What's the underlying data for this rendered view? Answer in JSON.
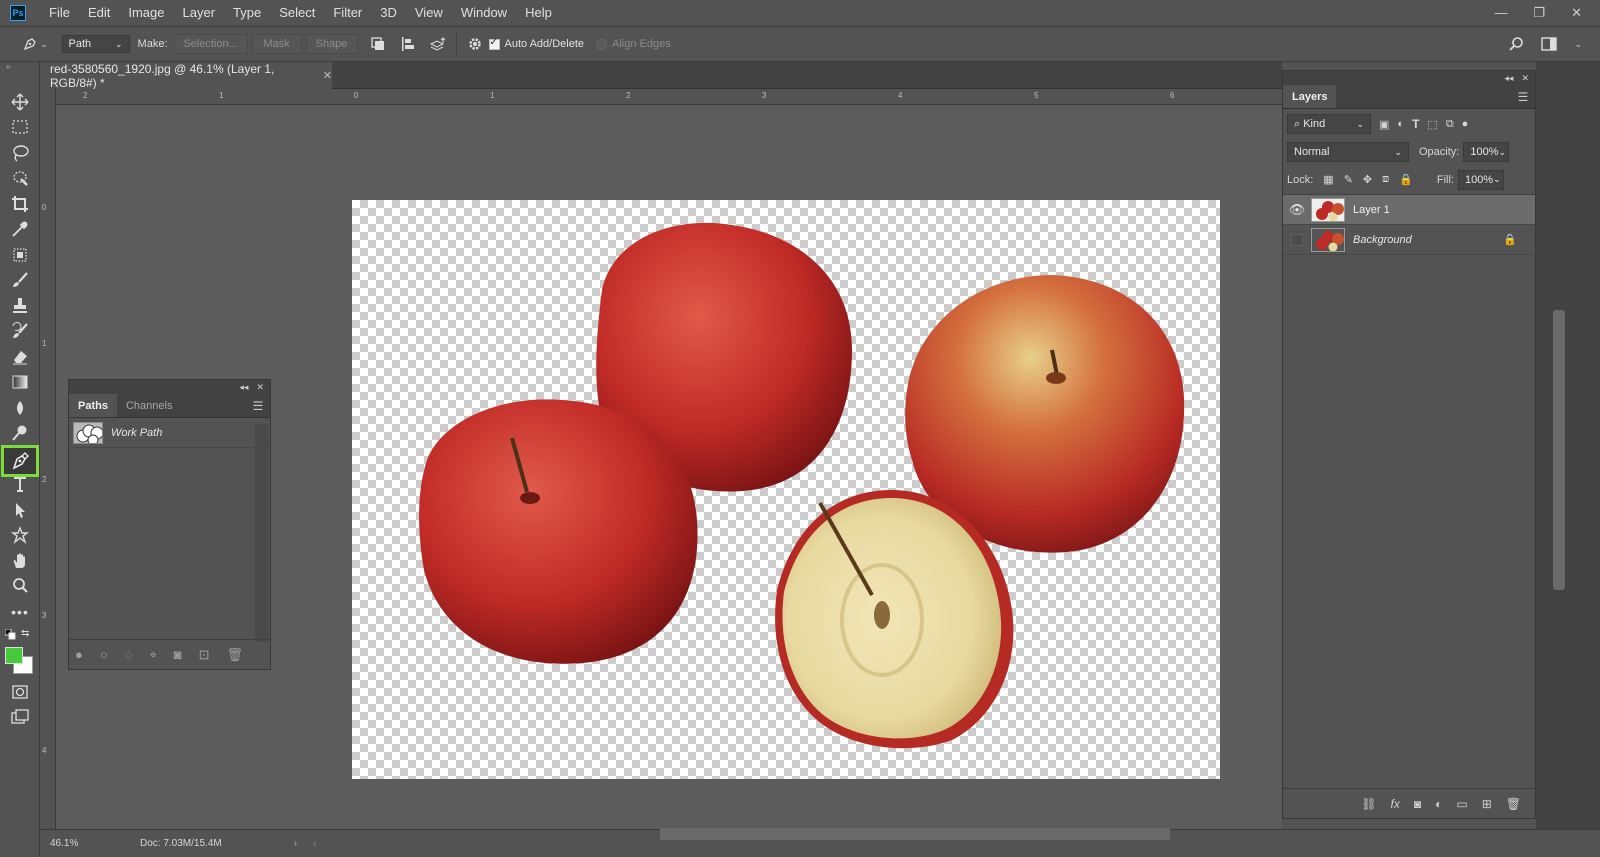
{
  "app": {
    "logo": "Ps"
  },
  "menu": [
    "File",
    "Edit",
    "Image",
    "Layer",
    "Type",
    "Select",
    "Filter",
    "3D",
    "View",
    "Window",
    "Help"
  ],
  "window_controls": {
    "minimize": "—",
    "restore": "❐",
    "close": "✕"
  },
  "options_bar": {
    "tool_mode": "Path",
    "make_label": "Make:",
    "selection_button": "Selection...",
    "mask_button": "Mask",
    "shape_button": "Shape",
    "auto_add_delete": "Auto Add/Delete",
    "align_edges": "Align Edges"
  },
  "document": {
    "tab_title": "red-3580560_1920.jpg @ 46.1% (Layer 1, RGB/8#) *",
    "close": "✕"
  },
  "rulers": {
    "h_ticks": [
      "2",
      "1",
      "0",
      "1",
      "2",
      "3",
      "4",
      "5",
      "6"
    ],
    "v_ticks": [
      "0",
      "1",
      "2",
      "3",
      "4"
    ]
  },
  "paths_panel": {
    "tabs": [
      "Paths",
      "Channels"
    ],
    "rows": [
      {
        "name": "Work Path"
      }
    ]
  },
  "layers_panel": {
    "title": "Layers",
    "filter_label": "Kind",
    "blend_mode": "Normal",
    "opacity_label": "Opacity:",
    "opacity_value": "100%",
    "lock_label": "Lock:",
    "fill_label": "Fill:",
    "fill_value": "100%",
    "layers": [
      {
        "name": "Layer 1",
        "visible": true,
        "selected": true
      },
      {
        "name": "Background",
        "visible": false,
        "selected": false,
        "locked": true
      }
    ]
  },
  "status": {
    "zoom": "46.1%",
    "doc": "Doc: 7.03M/15.4M"
  },
  "colors": {
    "foreground": "#46c93b",
    "background": "#ffffff",
    "active_tool_highlight": "#7bdc3a"
  }
}
